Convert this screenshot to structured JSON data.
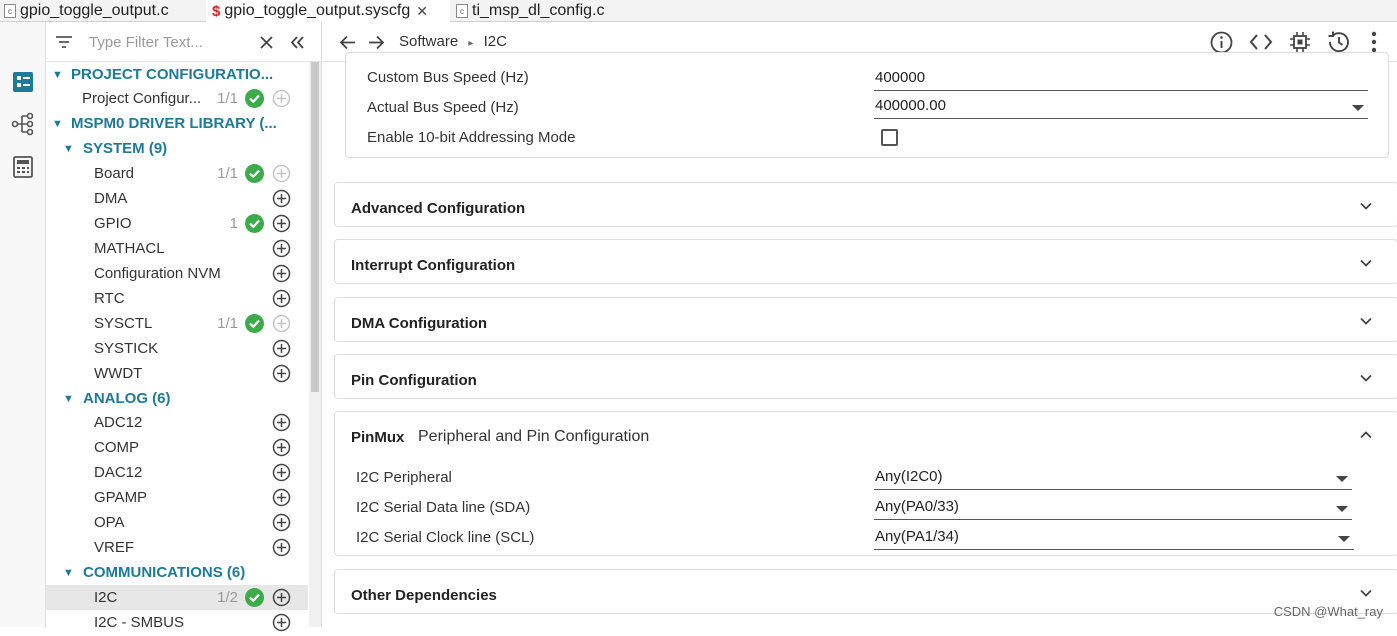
{
  "tabs": [
    {
      "label": "gpio_toggle_output.c",
      "icon": "c-file-icon",
      "active": false
    },
    {
      "label": "gpio_toggle_output.syscfg",
      "icon": "syscfg-icon",
      "active": true
    },
    {
      "label": "ti_msp_dl_config.c",
      "icon": "c-file-icon",
      "active": false
    }
  ],
  "filter": {
    "placeholder": "Type Filter Text..."
  },
  "tree": {
    "project_cat": "PROJECT CONFIGURATIO...",
    "project_item": {
      "label": "Project Configur...",
      "count": "1/1"
    },
    "driver_cat": "MSPM0 DRIVER LIBRARY (...",
    "system_cat": "SYSTEM (9)",
    "system_items": [
      {
        "label": "Board",
        "count": "1/1"
      },
      {
        "label": "DMA",
        "count": ""
      },
      {
        "label": "GPIO",
        "count": "1"
      },
      {
        "label": "MATHACL",
        "count": ""
      },
      {
        "label": "Configuration NVM",
        "count": ""
      },
      {
        "label": "RTC",
        "count": ""
      },
      {
        "label": "SYSCTL",
        "count": "1/1"
      },
      {
        "label": "SYSTICK",
        "count": ""
      },
      {
        "label": "WWDT",
        "count": ""
      }
    ],
    "analog_cat": "ANALOG (6)",
    "analog_items": [
      {
        "label": "ADC12"
      },
      {
        "label": "COMP"
      },
      {
        "label": "DAC12"
      },
      {
        "label": "GPAMP"
      },
      {
        "label": "OPA"
      },
      {
        "label": "VREF"
      }
    ],
    "comm_cat": "COMMUNICATIONS (6)",
    "comm_items": [
      {
        "label": "I2C",
        "count": "1/2"
      },
      {
        "label": "I2C - SMBUS",
        "count": ""
      }
    ]
  },
  "breadcrumb": {
    "root": "Software",
    "separator": "▸",
    "current": "I2C"
  },
  "bus": {
    "custom_label": "Custom Bus Speed (Hz)",
    "custom_value": "400000",
    "actual_label": "Actual Bus Speed (Hz)",
    "actual_value": "400000.00",
    "tenbit_label": "Enable 10-bit Addressing Mode"
  },
  "sections": {
    "advanced": "Advanced Configuration",
    "interrupt": "Interrupt Configuration",
    "dma": "DMA Configuration",
    "pin": "Pin Configuration",
    "other": "Other Dependencies"
  },
  "pinmux": {
    "title": "PinMux",
    "subtitle": "Peripheral and Pin Configuration",
    "rows": [
      {
        "label": "I2C Peripheral",
        "value": "Any(I2C0)"
      },
      {
        "label": "I2C Serial Data line (SDA)",
        "value": "Any(PA0/33)"
      },
      {
        "label": "I2C Serial Clock line (SCL)",
        "value": "Any(PA1/34)"
      }
    ]
  },
  "watermark": "CSDN @What_ray",
  "colors": {
    "accent": "#1c7a9a",
    "ok": "#3cab4a"
  }
}
